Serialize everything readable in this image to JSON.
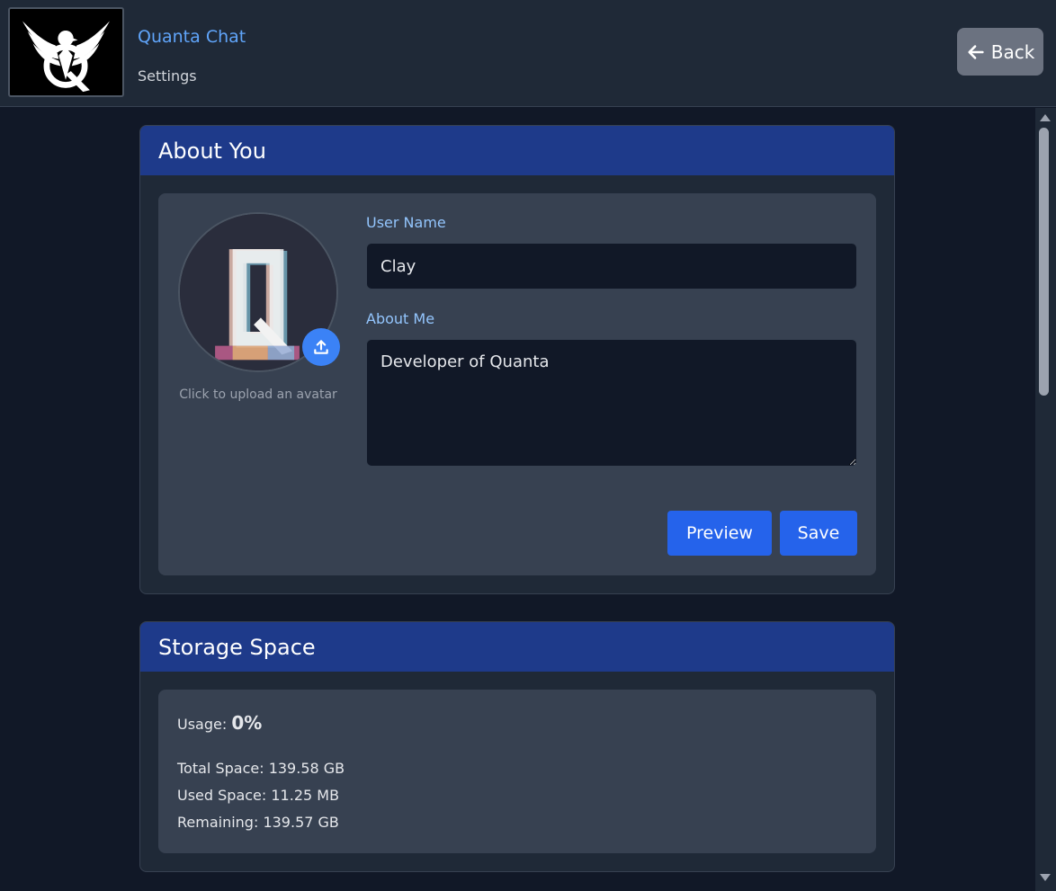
{
  "header": {
    "app_title": "Quanta Chat",
    "page_subtitle": "Settings",
    "back_label": "Back"
  },
  "about_panel": {
    "title": "About You",
    "avatar_hint": "Click to upload an avatar",
    "username_label": "User Name",
    "username_value": "Clay",
    "about_label": "About Me",
    "about_value": "Developer of Quanta",
    "preview_label": "Preview",
    "save_label": "Save"
  },
  "storage_panel": {
    "title": "Storage Space",
    "usage_label": "Usage:",
    "usage_value": "0%",
    "total": "Total Space: 139.58 GB",
    "used": "Used Space: 11.25 MB",
    "remaining": "Remaining: 139.57 GB"
  },
  "colors": {
    "background": "#111827",
    "header_bg": "#1f2937",
    "panel_header": "#1e3a8a",
    "accent": "#2563eb",
    "link": "#60a5fa"
  },
  "icons": {
    "logo": "eagle-q-logo",
    "back": "arrow-left-icon",
    "upload": "upload-icon"
  }
}
